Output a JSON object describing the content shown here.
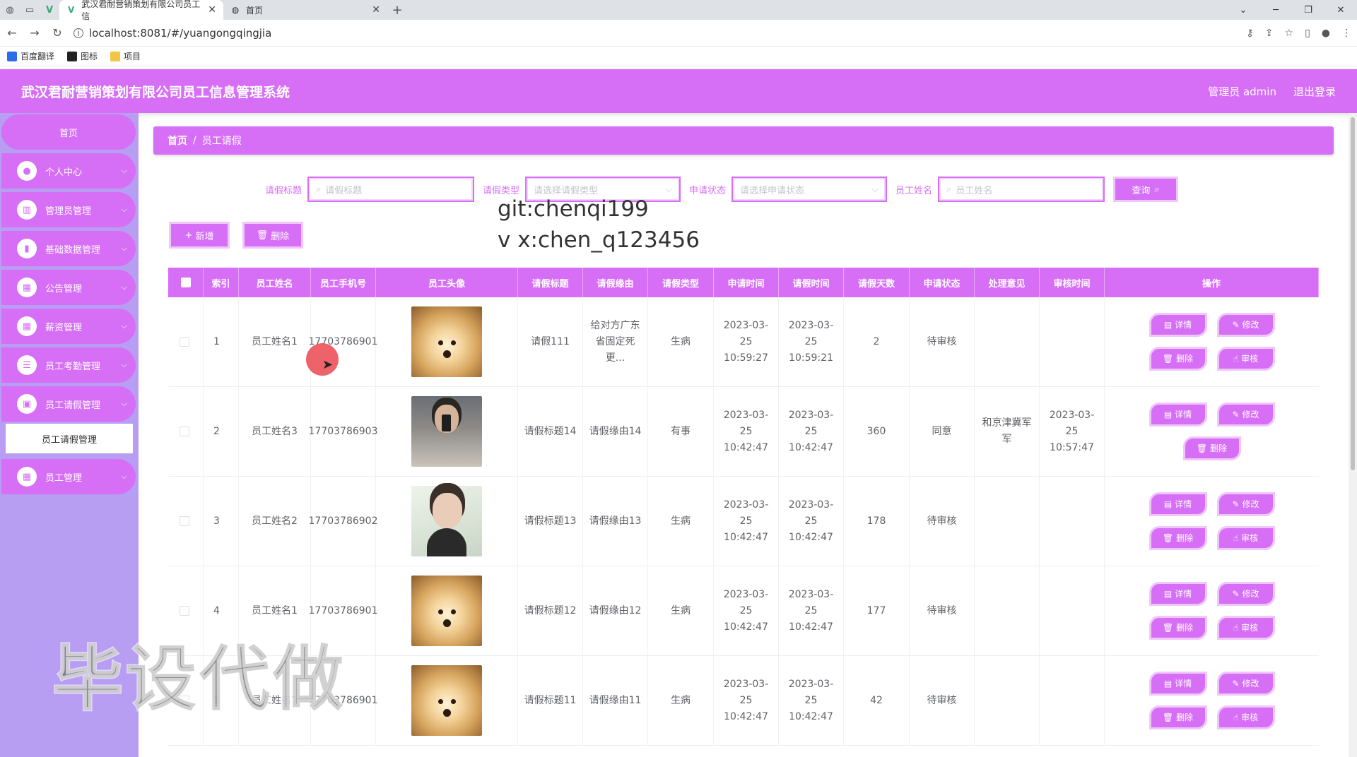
{
  "browser": {
    "tabs": [
      {
        "title": "武汉君耐营销策划有限公司员工信"
      },
      {
        "title": "首页"
      }
    ],
    "url": "localhost:8081/#/yuangongqingjia",
    "bookmarks": [
      "百度翻译",
      "图标",
      "项目"
    ]
  },
  "header": {
    "title": "武汉君耐营销策划有限公司员工信息管理系统",
    "user": "管理员 admin",
    "logout": "退出登录"
  },
  "sidebar": {
    "home": "首页",
    "items": [
      {
        "label": "个人中心"
      },
      {
        "label": "管理员管理"
      },
      {
        "label": "基础数据管理"
      },
      {
        "label": "公告管理"
      },
      {
        "label": "薪资管理"
      },
      {
        "label": "员工考勤管理"
      },
      {
        "label": "员工请假管理"
      },
      {
        "label": "员工管理"
      }
    ],
    "sub_item": "员工请假管理"
  },
  "breadcrumb": {
    "home": "首页",
    "sep": "/",
    "current": "员工请假"
  },
  "search": {
    "title_label": "请假标题",
    "title_placeholder": "请假标题",
    "type_label": "请假类型",
    "type_placeholder": "请选择请假类型",
    "status_label": "申请状态",
    "status_placeholder": "请选择申请状态",
    "name_label": "员工姓名",
    "name_placeholder": "员工姓名",
    "query_button": "查询"
  },
  "overlay": {
    "git": "git:chenqi199",
    "vx": "v x:chen_q123456",
    "big_watermark": "毕设代做"
  },
  "actions": {
    "add": "新增",
    "delete": "删除"
  },
  "table": {
    "headers": [
      "索引",
      "员工姓名",
      "员工手机号",
      "员工头像",
      "请假标题",
      "请假缘由",
      "请假类型",
      "申请时间",
      "请假时间",
      "请假天数",
      "申请状态",
      "处理意见",
      "审核时间",
      "操作"
    ],
    "rows": [
      {
        "idx": "1",
        "name": "员工姓名1",
        "phone": "17703786901",
        "avatar": "dog",
        "title": "请假111",
        "reason": "给对方广东省固定死更...",
        "type": "生病",
        "apply": "2023-03-25 10:59:27",
        "leave": "2023-03-25 10:59:21",
        "days": "2",
        "status": "待审核",
        "opinion": "",
        "audit": "",
        "ops": [
          "详情",
          "修改",
          "删除",
          "审核"
        ]
      },
      {
        "idx": "2",
        "name": "员工姓名3",
        "phone": "17703786903",
        "avatar": "man",
        "title": "请假标题14",
        "reason": "请假缘由14",
        "type": "有事",
        "apply": "2023-03-25 10:42:47",
        "leave": "2023-03-25 10:42:47",
        "days": "360",
        "status": "同意",
        "opinion": "和京津冀军军",
        "audit": "2023-03-25 10:57:47",
        "ops": [
          "详情",
          "修改",
          "删除"
        ]
      },
      {
        "idx": "3",
        "name": "员工姓名2",
        "phone": "17703786902",
        "avatar": "boy",
        "title": "请假标题13",
        "reason": "请假缘由13",
        "type": "生病",
        "apply": "2023-03-25 10:42:47",
        "leave": "2023-03-25 10:42:47",
        "days": "178",
        "status": "待审核",
        "opinion": "",
        "audit": "",
        "ops": [
          "详情",
          "修改",
          "删除",
          "审核"
        ]
      },
      {
        "idx": "4",
        "name": "员工姓名1",
        "phone": "17703786901",
        "avatar": "dog",
        "title": "请假标题12",
        "reason": "请假缘由12",
        "type": "生病",
        "apply": "2023-03-25 10:42:47",
        "leave": "2023-03-25 10:42:47",
        "days": "177",
        "status": "待审核",
        "opinion": "",
        "audit": "",
        "ops": [
          "详情",
          "修改",
          "删除",
          "审核"
        ]
      },
      {
        "idx": "5",
        "name": "员工姓名1",
        "phone": "17703786901",
        "avatar": "dog",
        "title": "请假标题11",
        "reason": "请假缘由11",
        "type": "生病",
        "apply": "2023-03-25 10:42:47",
        "leave": "2023-03-25 10:42:47",
        "days": "42",
        "status": "待审核",
        "opinion": "",
        "audit": "",
        "ops": [
          "详情",
          "修改",
          "删除",
          "审核"
        ]
      }
    ]
  },
  "colors": {
    "primary": "#d66ff6",
    "sidebar_bg": "#b79ef3",
    "button_border": "#f0c6fb"
  }
}
